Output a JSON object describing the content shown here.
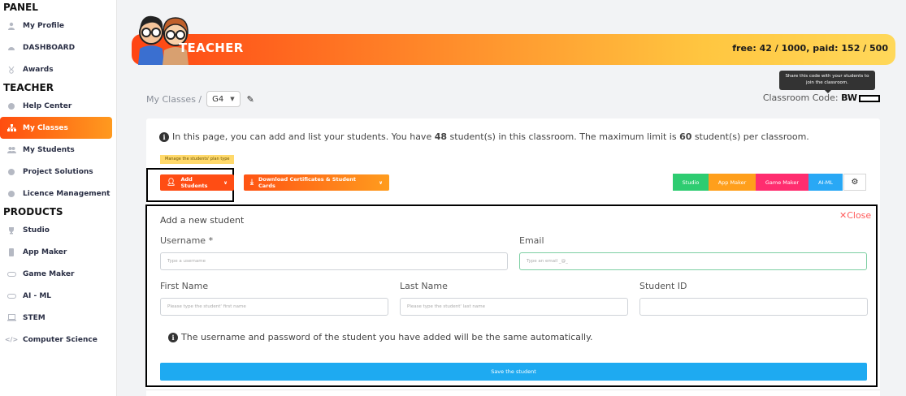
{
  "sidebar": {
    "sections": [
      {
        "title": "PANEL",
        "items": [
          {
            "label": "My Profile",
            "icon": "user-icon"
          },
          {
            "label": "DASHBOARD",
            "icon": "dashboard-icon"
          },
          {
            "label": "Awards",
            "icon": "award-icon"
          }
        ]
      },
      {
        "title": "TEACHER",
        "items": [
          {
            "label": "Help Center",
            "icon": "help-icon"
          },
          {
            "label": "My Classes",
            "icon": "classes-icon",
            "active": true
          },
          {
            "label": "My Students",
            "icon": "students-icon"
          },
          {
            "label": "Project Solutions",
            "icon": "solutions-icon"
          },
          {
            "label": "Licence Management",
            "icon": "licence-icon"
          }
        ]
      },
      {
        "title": "PRODUCTS",
        "items": [
          {
            "label": "Studio",
            "icon": "trophy-icon"
          },
          {
            "label": "App Maker",
            "icon": "phone-icon"
          },
          {
            "label": "Game Maker",
            "icon": "gamepad-icon"
          },
          {
            "label": "AI - ML",
            "icon": "ai-icon"
          },
          {
            "label": "STEM",
            "icon": "laptop-icon"
          },
          {
            "label": "Computer Science",
            "icon": "code-icon"
          }
        ]
      }
    ]
  },
  "banner": {
    "title": "TEACHER",
    "stats": "free: 42 / 1000, paid: 152 / 500"
  },
  "breadcrumb": {
    "root": "My Classes /",
    "selected_class": "G4"
  },
  "tooltip": "Share this code with your students to join the classroom.",
  "classroom_code": {
    "label": "Classroom Code:",
    "value": "BW"
  },
  "info": {
    "text_1": "In this page, you can add and list your students. You have ",
    "student_count": "48",
    "text_2": " student(s) in this classroom. The maximum limit is ",
    "limit": "60",
    "text_3": " student(s) per classroom."
  },
  "plan_tag": "Manage the students' plan type",
  "buttons": {
    "add_students": "Add Students",
    "download": "Download Certificates & Student Cards"
  },
  "product_pills": [
    {
      "label": "Studio",
      "color": "#2ecc71"
    },
    {
      "label": "App Maker",
      "color": "#ff9f1c"
    },
    {
      "label": "Game Maker",
      "color": "#ff2d6f"
    },
    {
      "label": "AI-ML",
      "color": "#29a8f5"
    }
  ],
  "form": {
    "title": "Add a new student",
    "close": "Close",
    "username_label": "Username *",
    "username_placeholder": "Type a username",
    "email_label": "Email",
    "email_placeholder": "Type an email _@_",
    "firstname_label": "First Name",
    "firstname_placeholder": "Please type the student' first name",
    "lastname_label": "Last Name",
    "lastname_placeholder": "Please type the student' last name",
    "studentid_label": "Student ID",
    "studentid_placeholder": "",
    "note": "The username and password of the student you have added will be the same automatically.",
    "save": "Save the student"
  }
}
